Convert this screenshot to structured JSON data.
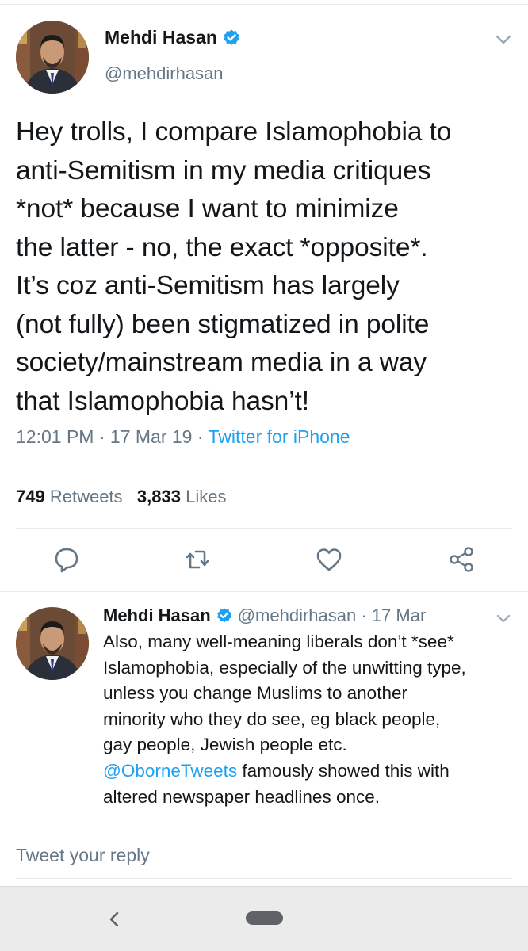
{
  "main_tweet": {
    "author": {
      "display_name": "Mehdi Hasan",
      "handle": "@mehdirhasan",
      "verified": true
    },
    "text_lines": [
      "Hey trolls, I compare Islamophobia to",
      "anti-Semitism in my media critiques",
      "*not* because I want to minimize",
      "the latter - no, the exact *opposite*.",
      "It’s coz anti-Semitism has largely",
      "(not fully) been stigmatized in polite",
      "society/mainstream media in a way",
      "that Islamophobia hasn’t!"
    ],
    "time": "12:01 PM",
    "date": "17 Mar 19",
    "separator": "·",
    "source": "Twitter for iPhone",
    "retweets_count": "749",
    "retweets_label": "Retweets",
    "likes_count": "3,833",
    "likes_label": "Likes"
  },
  "actions": [
    {
      "name": "reply",
      "icon": "speech-bubble-icon"
    },
    {
      "name": "retweet",
      "icon": "retweet-icon"
    },
    {
      "name": "like",
      "icon": "heart-icon"
    },
    {
      "name": "share",
      "icon": "share-icon"
    }
  ],
  "reply_tweet": {
    "display_name": "Mehdi Hasan",
    "handle": "@mehdirhasan",
    "separator": "·",
    "date": "17 Mar",
    "text_lines": [
      "Also, many well-meaning liberals don’t *see*",
      "Islamophobia, especially of the unwitting type,",
      "unless you change Muslims to another",
      "minority who they do see, eg black people,",
      "gay people, Jewish people etc."
    ],
    "mention": "@OborneTweets",
    "after_mention": " famously showed this with",
    "last_line": "altered newspaper headlines once."
  },
  "composer": {
    "placeholder": "Tweet your reply"
  },
  "colors": {
    "accent": "#1da1f2",
    "secondary_text": "#657786",
    "divider": "#e6ecf0"
  }
}
